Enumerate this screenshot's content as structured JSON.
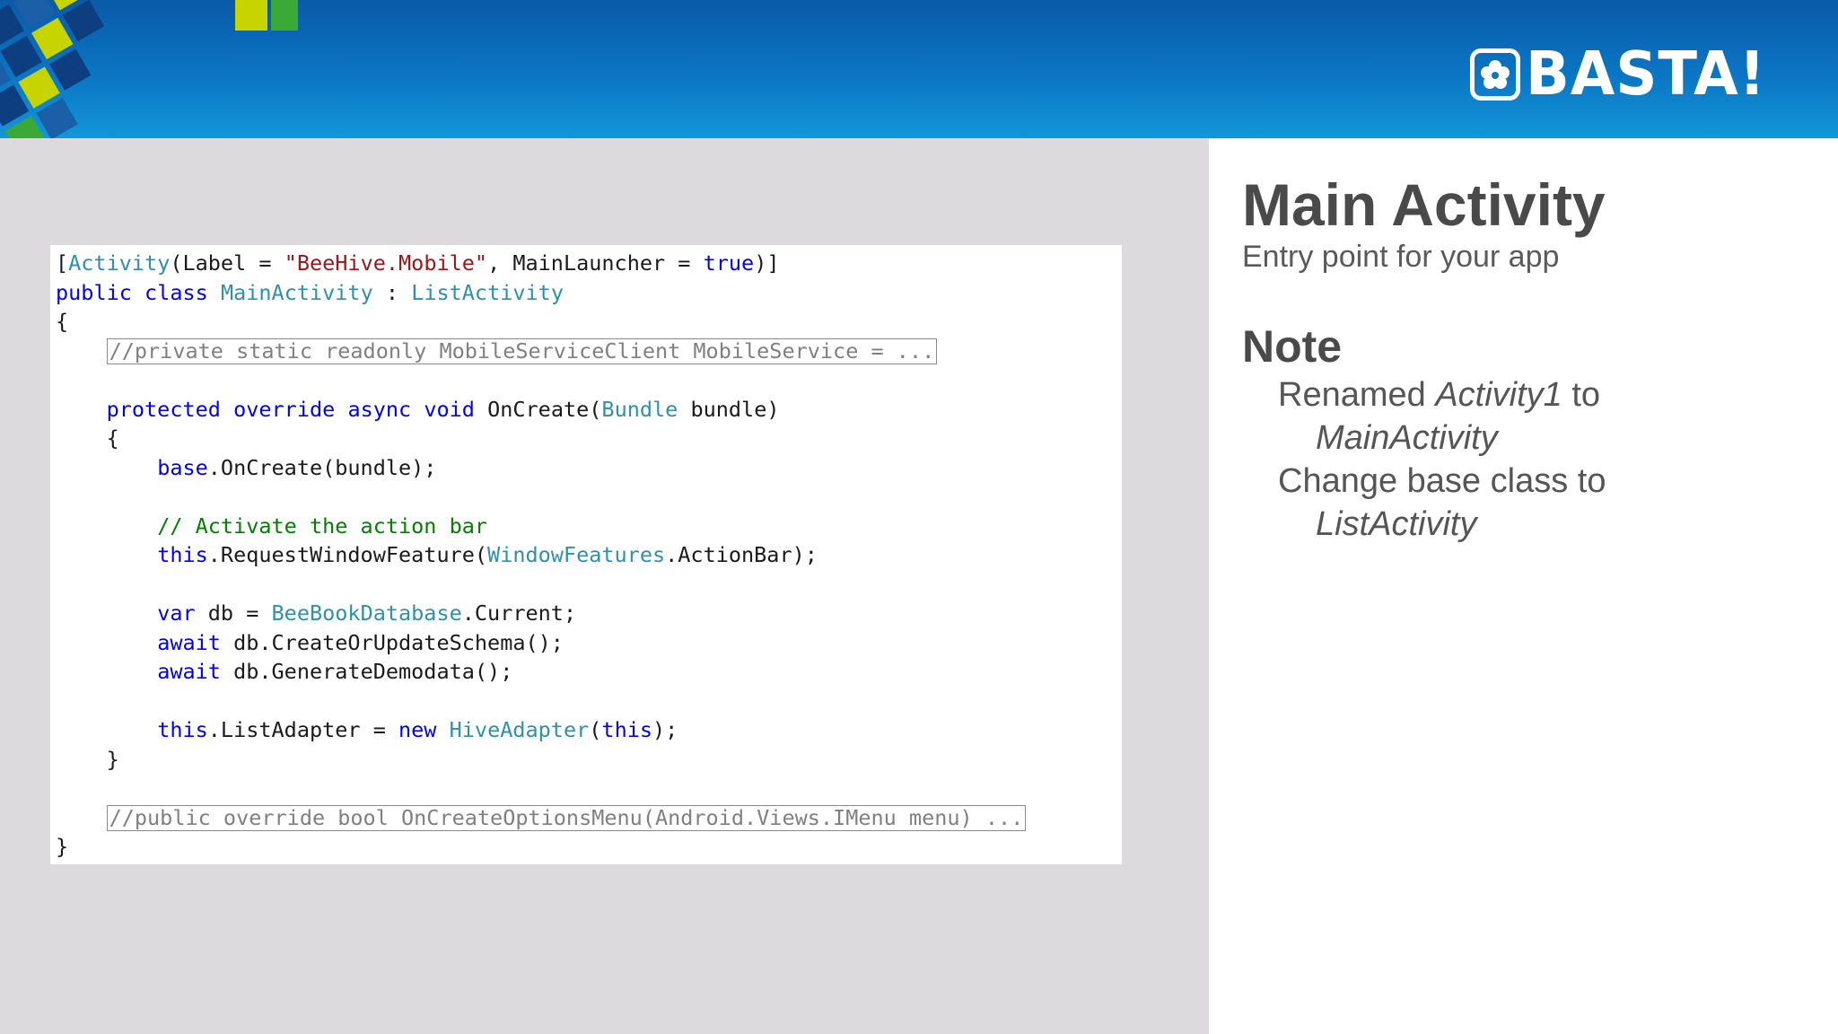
{
  "header": {
    "logo_text": "BASTA!",
    "colors": {
      "bg_top": "#0a5aa8",
      "bg_bottom": "#1396d8",
      "deco_dark": "#0d3f80",
      "deco_yellow": "#c8d400",
      "deco_green": "#3aa935"
    }
  },
  "code": {
    "lines": {
      "l1_a": "[",
      "l1_type": "Activity",
      "l1_b": "(Label = ",
      "l1_str": "\"BeeHive.Mobile\"",
      "l1_c": ", MainLauncher = ",
      "l1_kw": "true",
      "l1_d": ")]",
      "l2_kw1": "public",
      "l2_kw2": "class",
      "l2_type1": "MainActivity",
      "l2_colon": " : ",
      "l2_type2": "ListActivity",
      "l3": "{",
      "l4_collapsed": "//private static readonly MobileServiceClient MobileService = ...",
      "l6_kw1": "protected",
      "l6_kw2": "override",
      "l6_kw3": "async",
      "l6_kw4": "void",
      "l6_a": " OnCreate(",
      "l6_type": "Bundle",
      "l6_b": " bundle)",
      "l7": "{",
      "l8_kw": "base",
      "l8_a": ".OnCreate(bundle);",
      "l10_comment": "// Activate the action bar",
      "l11_kw": "this",
      "l11_a": ".RequestWindowFeature(",
      "l11_type": "WindowFeatures",
      "l11_b": ".ActionBar);",
      "l13_kw": "var",
      "l13_a": " db = ",
      "l13_type": "BeeBookDatabase",
      "l13_b": ".Current;",
      "l14_kw": "await",
      "l14_a": " db.CreateOrUpdateSchema();",
      "l15_kw": "await",
      "l15_a": " db.GenerateDemodata();",
      "l17_kw1": "this",
      "l17_a": ".ListAdapter = ",
      "l17_kw2": "new",
      "l17_type": "HiveAdapter",
      "l17_b": "(",
      "l17_kw3": "this",
      "l17_c": ");",
      "l18": "}",
      "l20_collapsed": "//public override bool OnCreateOptionsMenu(Android.Views.IMenu menu) ...",
      "l21": "}"
    },
    "colors": {
      "keyword": "#0000ff",
      "type": "#2b91af",
      "string": "#a31515",
      "comment": "#008000"
    }
  },
  "side": {
    "title": "Main Activity",
    "subtitle": "Entry point for your app",
    "note_heading": "Note",
    "notes": [
      {
        "prefix": "Renamed ",
        "italic": "Activity1",
        "suffix": " to",
        "line2": "MainActivity"
      },
      {
        "prefix": "Change base class to",
        "italic": "",
        "suffix": "",
        "line2": "ListActivity"
      }
    ]
  }
}
